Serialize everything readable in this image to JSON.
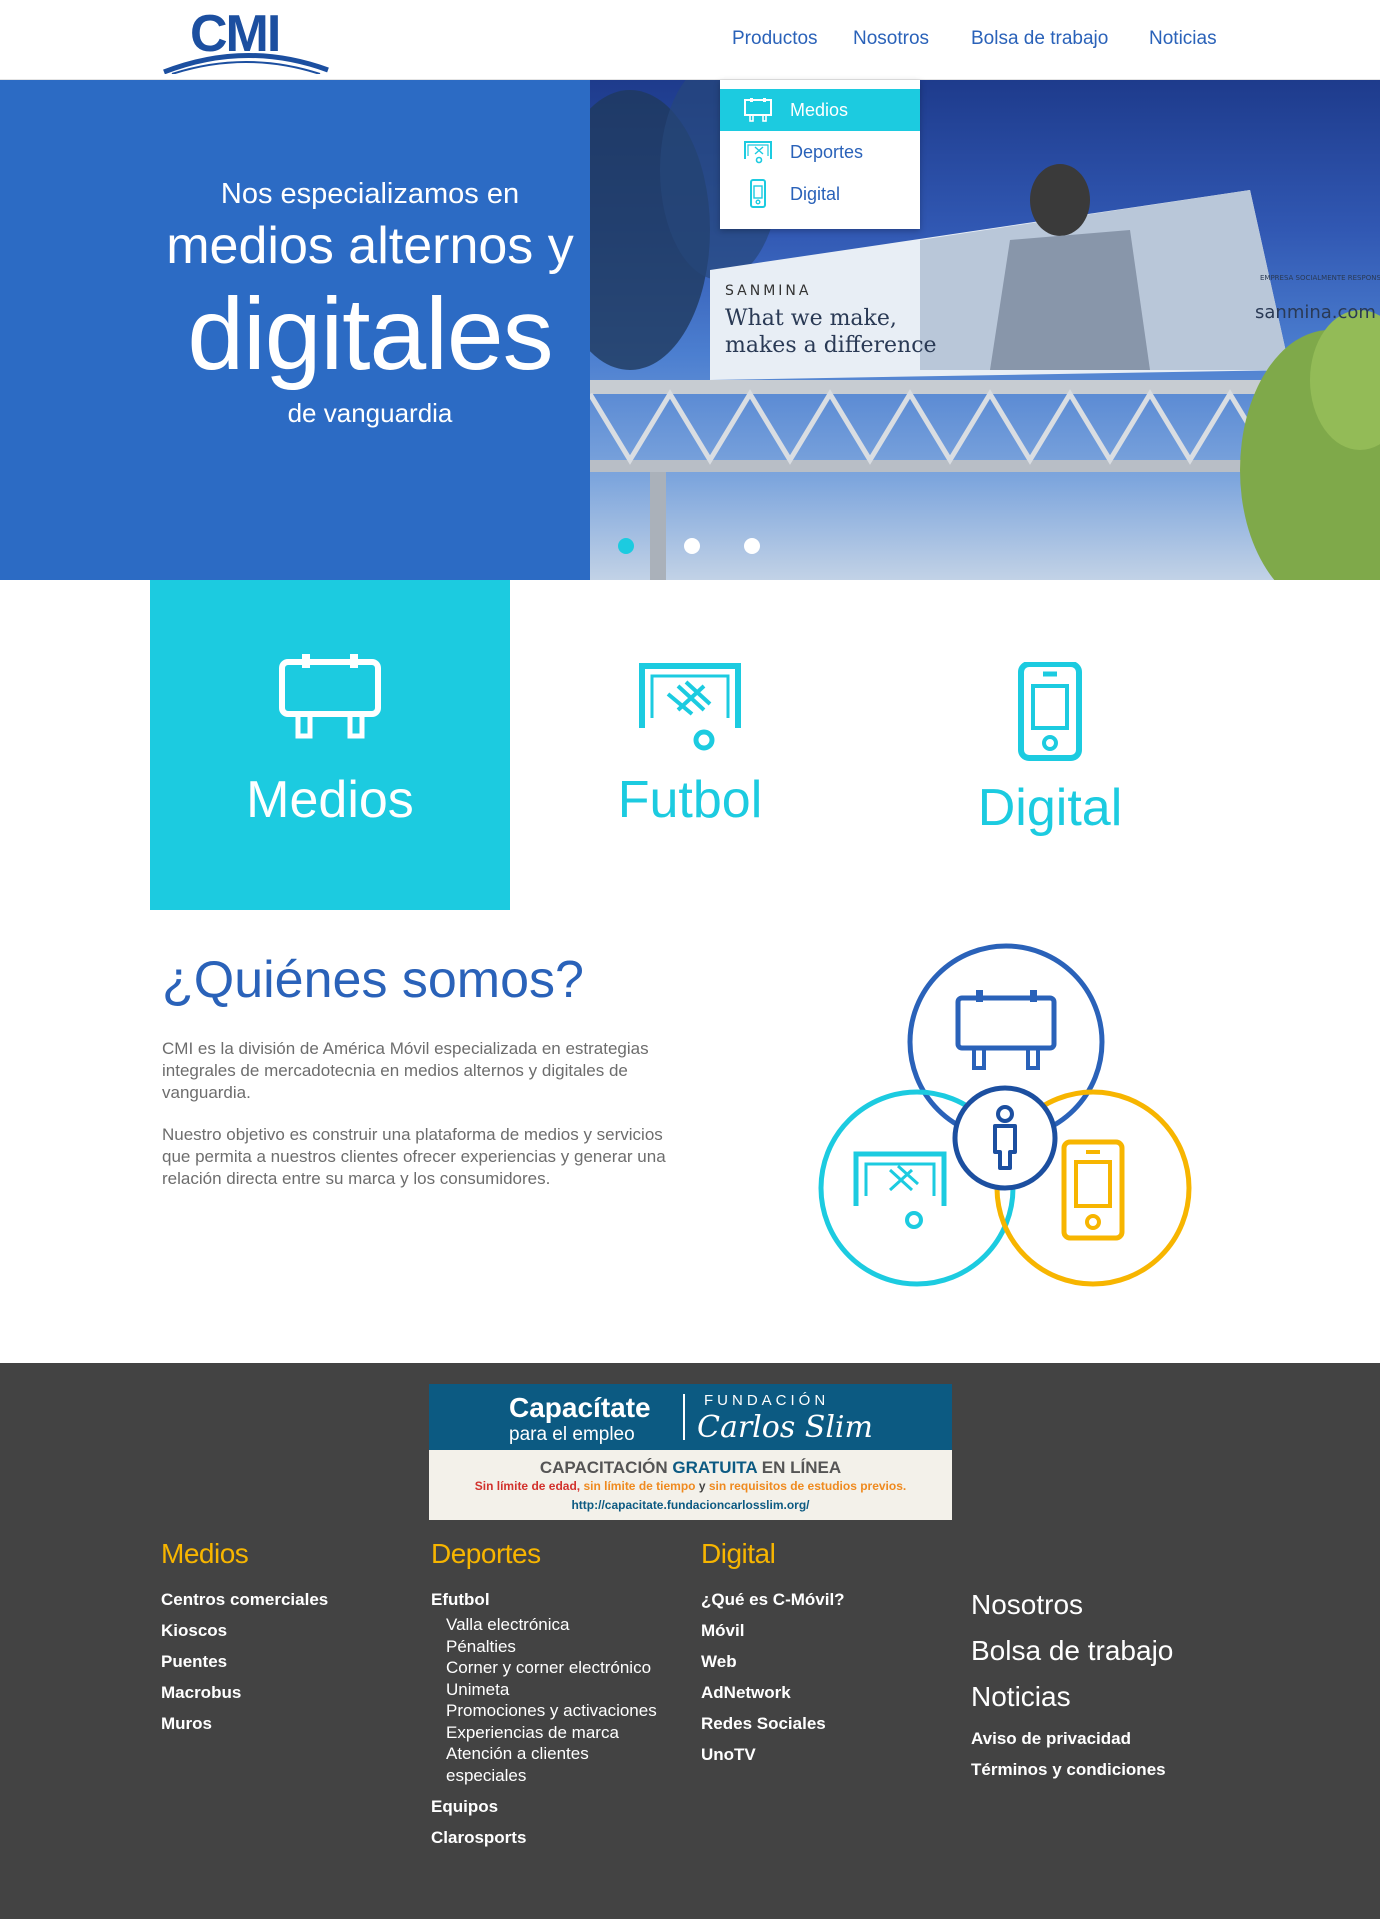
{
  "header": {
    "logo_text": "CMI",
    "nav": [
      {
        "label": "Productos"
      },
      {
        "label": "Nosotros"
      },
      {
        "label": "Bolsa de trabajo"
      },
      {
        "label": "Noticias"
      }
    ],
    "dropdown": [
      {
        "label": "Medios",
        "icon": "billboard-icon",
        "active": true
      },
      {
        "label": "Deportes",
        "icon": "soccer-goal-icon",
        "active": false
      },
      {
        "label": "Digital",
        "icon": "mobile-phone-icon",
        "active": false
      }
    ]
  },
  "hero": {
    "line1": "Nos especializamos en",
    "line2": "medios alternos y",
    "line3": "digitales",
    "line4": "de vanguardia",
    "billboard_brand": "SANMINA",
    "billboard_slogan_1": "What we make,",
    "billboard_slogan_2": "makes a difference",
    "billboard_url": "sanmina.com",
    "billboard_badge": "EMPRESA SOCIALMENTE RESPONSABLE",
    "slides_total": 3,
    "slide_active": 1
  },
  "categories": [
    {
      "label": "Medios",
      "icon": "billboard-icon",
      "active": true
    },
    {
      "label": "Futbol",
      "icon": "soccer-goal-icon",
      "active": false
    },
    {
      "label": "Digital",
      "icon": "mobile-phone-icon",
      "active": false
    }
  ],
  "about": {
    "title": "¿Quiénes somos?",
    "p1": "CMI es la división de América Móvil especializada en estrategias integrales de mercadotecnia en medios alternos y digitales de vanguardia.",
    "p2": "Nuestro objetivo es construir una plataforma de medios y servicios que permita a nuestros clientes ofrecer experiencias y generar una relación directa entre su marca y los consumidores."
  },
  "banner": {
    "title": "Capacítate",
    "subtitle": "para el empleo",
    "foundation_label": "FUNDACIÓN",
    "foundation_name": "Carlos Slim",
    "line1_a": "CAPACITACIÓN ",
    "line1_b": "GRATUITA",
    "line1_c": " EN LÍNEA",
    "line2_a": "Sin límite de edad, ",
    "line2_b": "sin límite de tiempo",
    "line2_c": " y ",
    "line2_d": "sin requisitos de estudios previos.",
    "url": "http://capacitate.fundacioncarlosslim.org/"
  },
  "footer": {
    "medios": {
      "title": "Medios",
      "links": [
        "Centros comerciales",
        "Kioscos",
        "Puentes",
        "Macrobus",
        "Muros"
      ]
    },
    "deportes": {
      "title": "Deportes",
      "efutbol": "Efutbol",
      "sublinks": [
        "Valla electrónica",
        "Pénalties",
        "Corner y corner electrónico",
        "Unimeta",
        "Promociones y activaciones",
        "Experiencias de marca",
        "Atención a clientes especiales"
      ],
      "equipos": "Equipos",
      "clarosports": "Clarosports"
    },
    "digital": {
      "title": "Digital",
      "links": [
        "¿Qué es C-Móvil?",
        "Móvil",
        "Web",
        "AdNetwork",
        "Redes Sociales",
        "UnoTV"
      ]
    },
    "general": {
      "big_links": [
        "Nosotros",
        "Bolsa de trabajo",
        "Noticias"
      ],
      "small_links": [
        "Aviso de privacidad",
        "Términos y condiciones"
      ]
    }
  },
  "colors": {
    "brand_blue": "#2a62b9",
    "cyan": "#1ccbe0",
    "yellow": "#f7b500",
    "footer_bg": "#434343"
  }
}
